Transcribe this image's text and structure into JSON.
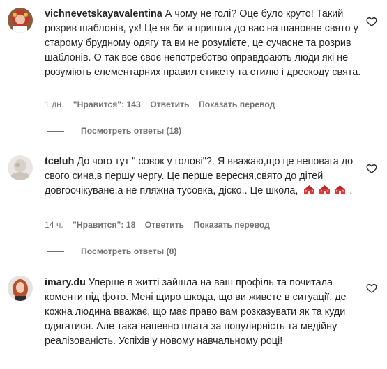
{
  "comments": [
    {
      "username": "vichnevetskayavalentina",
      "text": "А чому не голі? Оце було круто! Такий розрив шаблонів, ух! Це як би я пришла до вас на шановне свято у старому брудному одягу та ви не розумієте, це сучасне та розрив шаблонів. О так все своє непотребство оправдоають люди які не розуміють елементарних правил етикету та стилю і дрескоду свята.",
      "time": "1 дн.",
      "likes": "\"Нравится\": 143",
      "reply": "Ответить",
      "translate": "Показать перевод",
      "replies": "Посмотреть ответы (18)",
      "avatar_icon": "avatar-woman-icon"
    },
    {
      "username": "tceluh",
      "text": "До чого тут \" совок у голові\"?. Я вважаю,що це неповага до свого сина,в першу чергу. Це перше вересня,свято до дітей довгоочікуване,а не пляжна тусовка, діско.. Це школа,",
      "emojis": [
        "school-icon",
        "school-icon",
        "school-icon"
      ],
      "text_end": ".",
      "time": "14 ч.",
      "likes": "\"Нравится\": 18",
      "reply": "Ответить",
      "translate": "Показать перевод",
      "replies": "Посмотреть ответы (8)",
      "avatar_icon": "avatar-blurred-icon"
    },
    {
      "username": "imary.du",
      "text": "Уперше в житті зайшла на ваш профіль та почитала коменти під фото. Мені щиро шкода, що ви живете в ситуації, де кожна людина вважає, що має право вам розказувати як та куди одягатися. Але така напевно плата за популярність та медійну реалізованість. Успіхів у новому навчальному році!",
      "avatar_icon": "avatar-redhair-icon"
    }
  ],
  "colors": {
    "text": "#262626",
    "secondary": "#737373",
    "background": "#ffffff",
    "school_red": "#d93a3a"
  }
}
